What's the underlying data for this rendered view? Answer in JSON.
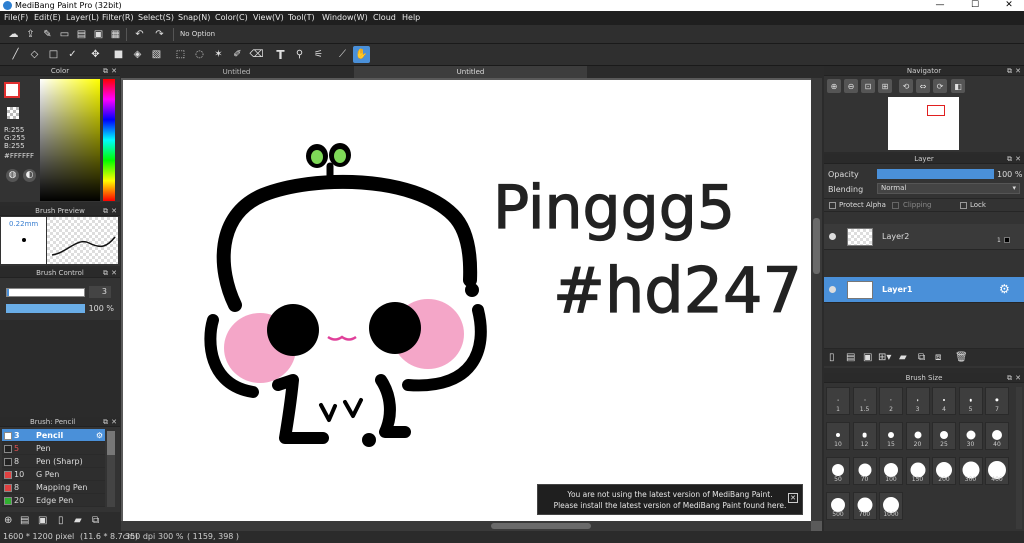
{
  "window": {
    "title": "MediBang Paint Pro (32bit)",
    "min": "—",
    "max": "☐",
    "close": "✕"
  },
  "menu": [
    "File(F)",
    "Edit(E)",
    "Layer(L)",
    "Filter(R)",
    "Select(S)",
    "Snap(N)",
    "Color(C)",
    "View(V)",
    "Tool(T)",
    "Window(W)",
    "Cloud",
    "Help"
  ],
  "toolbar1": {
    "option": "No Option"
  },
  "colorPanel": {
    "title": "Color",
    "r": "R:255",
    "g": "G:255",
    "b": "B:255",
    "hex": "#FFFFFF"
  },
  "brushPreview": {
    "title": "Brush Preview",
    "size": "0.22mm"
  },
  "brushControl": {
    "title": "Brush Control",
    "size": "3",
    "opacity": "100 %"
  },
  "brushList": {
    "title": "Brush: Pencil",
    "items": [
      {
        "num": "3",
        "name": "Pencil",
        "color": "#ffffff",
        "active": true
      },
      {
        "num": "5",
        "name": "Pen",
        "color": "#222222"
      },
      {
        "num": "8",
        "name": "Pen (Sharp)",
        "color": "#222222"
      },
      {
        "num": "10",
        "name": "G Pen",
        "color": "#e04040"
      },
      {
        "num": "8",
        "name": "Mapping Pen",
        "color": "#e04040"
      },
      {
        "num": "20",
        "name": "Edge Pen",
        "color": "#30b030"
      }
    ]
  },
  "tabs": {
    "tab1": "Untitled",
    "tab2": "Untitled"
  },
  "canvasText": {
    "line1": "Pinggg5",
    "line2": "#hd247"
  },
  "navigator": {
    "title": "Navigator"
  },
  "layerPanel": {
    "title": "Layer",
    "opacityLabel": "Opacity",
    "opacityValue": "100 %",
    "opacity": 1.0,
    "blendingLabel": "Blending",
    "blendingValue": "Normal",
    "protectAlpha": "Protect Alpha",
    "clipping": "Clipping",
    "lock": "Lock",
    "layers": [
      {
        "name": "Layer2",
        "badge": "1"
      },
      {
        "name": "Layer1"
      }
    ]
  },
  "brushSize": {
    "title": "Brush Size",
    "sizes": [
      "1",
      "1.5",
      "2",
      "3",
      "4",
      "5",
      "7",
      "10",
      "12",
      "15",
      "20",
      "25",
      "30",
      "40",
      "50",
      "70",
      "100",
      "150",
      "200",
      "300",
      "400",
      "500",
      "700",
      "1000"
    ]
  },
  "notice": {
    "line1": "You are not using the latest version of MediBang Paint.",
    "line2": "Please install the latest version of MediBang Paint found here."
  },
  "status": {
    "size": "1600 * 1200 pixel",
    "cm": "(11.6 * 8.7cm)",
    "dpi": "350 dpi",
    "zoom": "300 %",
    "coords": "( 1159, 398 )"
  },
  "colors": {
    "accent": "#4a90d9",
    "cheek": "#f4a6c8",
    "sprout": "#7ed957"
  }
}
